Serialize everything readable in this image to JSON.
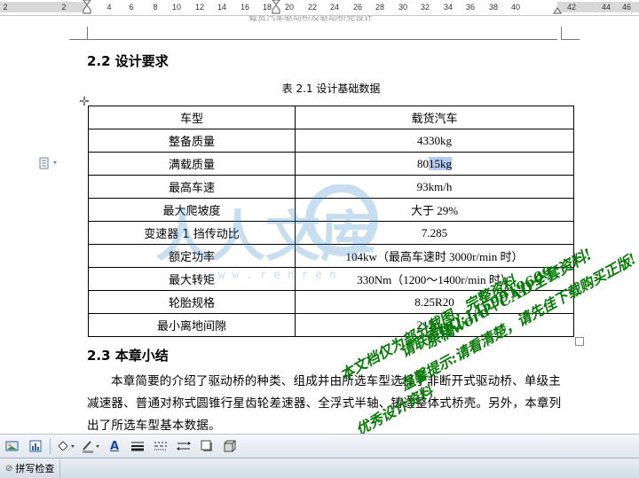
{
  "ruler": {
    "ticks": [
      "2",
      "2",
      "4",
      "6",
      "8",
      "10",
      "12",
      "14",
      "16",
      "18",
      "20",
      "22",
      "24",
      "26",
      "28",
      "30",
      "32",
      "34",
      "36",
      "38",
      "40",
      "42",
      "44",
      "46"
    ]
  },
  "header": {
    "text": "载货汽车驱动桥及驱动桥壳设计"
  },
  "section_22": {
    "title": "2.2  设计要求"
  },
  "table": {
    "caption": "表 2.1  设计基础数据",
    "rows": [
      {
        "label": "车型",
        "value": "载货汽车"
      },
      {
        "label": "整备质量",
        "value": "4330kg"
      },
      {
        "label": "满载质量",
        "value_prefix": "80",
        "value_highlight": "15kg"
      },
      {
        "label": "最高车速",
        "value": "93km/h"
      },
      {
        "label": "最大爬坡度",
        "value": "大于 29%"
      },
      {
        "label": "变速器 1 挡传动比",
        "value": "7.285"
      },
      {
        "label": "额定功率",
        "value": "104kw（最高车速时 3000r/min 时）"
      },
      {
        "label": "最大转矩",
        "value": "330Nm（1200～1400r/min 时）"
      },
      {
        "label": "轮胎规格",
        "value": "8.25R20"
      },
      {
        "label": "最小离地间隙",
        "value": "212mm"
      }
    ]
  },
  "section_23": {
    "title": "2.3  本章小结",
    "paragraph": "本章简要的介绍了驱动桥的种类、组成并由所选车型选择了非断开式驱动桥、单级主减速器、普通对称式圆锥行星齿轮差速器、全浮式半轴、铸造整体式桥壳。另外，本章列出了所选车型基本数据。"
  },
  "watermark": {
    "logo_text": "人人文库",
    "url_text": "w w w . r e n r e n",
    "stamp_lines": [
      "原稿word+CAD全套资料!",
      "请联系QQ:1459919609",
      "温馨提示:请看清楚，请先佳下载购买正版!",
      "本文档仅为部分截图，完整资料",
      "优秀设计资料"
    ],
    "color": "#0a7a0a"
  },
  "toolbar": {
    "font_color_label": "A",
    "accent": "#1a48b0"
  },
  "statusbar": {
    "spellcheck_label": "拼写检查"
  }
}
